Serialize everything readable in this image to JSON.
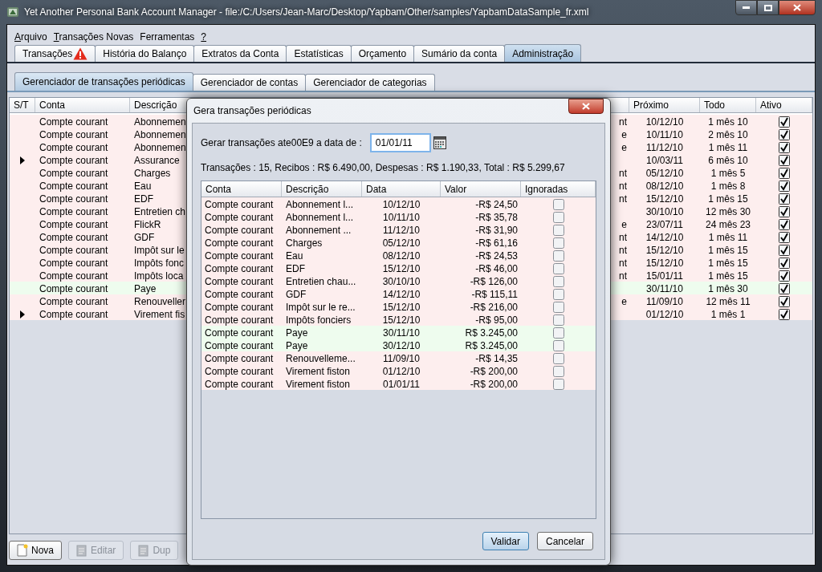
{
  "window": {
    "title": "Yet Another Personal Bank Account Manager - file:/C:/Users/Jean-Marc/Desktop/Yapbam/Other/samples/YapbamDataSample_fr.xml"
  },
  "menu": [
    {
      "label": "Arquivo",
      "mnemonic": true
    },
    {
      "label": "Transações Novas",
      "mnemonic": true
    },
    {
      "label": "Ferramentas",
      "mnemonic": false
    },
    {
      "label": "?",
      "mnemonic": true
    }
  ],
  "tabs": [
    {
      "label": "Transações",
      "selected": false,
      "warning": true
    },
    {
      "label": "História do Balanço",
      "selected": false,
      "warning": false
    },
    {
      "label": "Extratos da Conta",
      "selected": false,
      "warning": false
    },
    {
      "label": "Estatísticas",
      "selected": false,
      "warning": false
    },
    {
      "label": "Orçamento",
      "selected": false,
      "warning": false
    },
    {
      "label": "Sumário da conta",
      "selected": false,
      "warning": false
    },
    {
      "label": "Administração",
      "selected": true,
      "warning": false
    }
  ],
  "subtabs": [
    {
      "label": "Gerenciador de transações periódicas",
      "selected": true
    },
    {
      "label": "Gerenciador de contas",
      "selected": false
    },
    {
      "label": "Gerenciador de categorias",
      "selected": false
    }
  ],
  "table": {
    "columns": [
      "S/T",
      "Conta",
      "Descrição",
      "Próximo",
      "Todo",
      "Ativo"
    ],
    "rows": [
      {
        "expandable": false,
        "kind": "expense",
        "conta": "Compte courant",
        "descricao": "Abonnemen",
        "column_4": "nt",
        "proximo": "10/12/10",
        "todo": "1 mês 10",
        "ativo": true
      },
      {
        "expandable": false,
        "kind": "expense",
        "conta": "Compte courant",
        "descricao": "Abonnemen",
        "column_4": "e",
        "proximo": "10/11/10",
        "todo": "2 mês 10",
        "ativo": true
      },
      {
        "expandable": false,
        "kind": "expense",
        "conta": "Compte courant",
        "descricao": "Abonnemen",
        "column_4": "e",
        "proximo": "11/12/10",
        "todo": "1 mês 11",
        "ativo": true
      },
      {
        "expandable": true,
        "kind": "expense",
        "conta": "Compte courant",
        "descricao": "Assurance",
        "proximo": "10/03/11",
        "todo": "6 mês 10",
        "ativo": true
      },
      {
        "expandable": false,
        "kind": "expense",
        "conta": "Compte courant",
        "descricao": "Charges",
        "column_4": "nt",
        "proximo": "05/12/10",
        "todo": "1 mês 5",
        "ativo": true
      },
      {
        "expandable": false,
        "kind": "expense",
        "conta": "Compte courant",
        "descricao": "Eau",
        "column_4": "nt",
        "proximo": "08/12/10",
        "todo": "1 mês 8",
        "ativo": true
      },
      {
        "expandable": false,
        "kind": "expense",
        "conta": "Compte courant",
        "descricao": "EDF",
        "column_4": "nt",
        "proximo": "15/12/10",
        "todo": "1 mês 15",
        "ativo": true
      },
      {
        "expandable": false,
        "kind": "expense",
        "conta": "Compte courant",
        "descricao": "Entretien ch",
        "proximo": "30/10/10",
        "todo": "12 mês 30",
        "ativo": true
      },
      {
        "expandable": false,
        "kind": "expense",
        "conta": "Compte courant",
        "descricao": "FlickR",
        "column_4": "e",
        "proximo": "23/07/11",
        "todo": "24 mês 23",
        "ativo": true
      },
      {
        "expandable": false,
        "kind": "expense",
        "conta": "Compte courant",
        "descricao": "GDF",
        "column_4": "nt",
        "proximo": "14/12/10",
        "todo": "1 mês 11",
        "ativo": true
      },
      {
        "expandable": false,
        "kind": "expense",
        "conta": "Compte courant",
        "descricao": "Impôt sur le",
        "column_4": "nt",
        "proximo": "15/12/10",
        "todo": "1 mês 15",
        "ativo": true
      },
      {
        "expandable": false,
        "kind": "expense",
        "conta": "Compte courant",
        "descricao": "Impôts fonc",
        "column_4": "nt",
        "proximo": "15/12/10",
        "todo": "1 mês 15",
        "ativo": true
      },
      {
        "expandable": false,
        "kind": "expense",
        "conta": "Compte courant",
        "descricao": "Impôts loca",
        "column_4": "nt",
        "proximo": "15/01/11",
        "todo": "1 mês 15",
        "ativo": true
      },
      {
        "expandable": false,
        "kind": "income",
        "conta": "Compte courant",
        "descricao": "Paye",
        "proximo": "30/11/10",
        "todo": "1 mês 30",
        "ativo": true
      },
      {
        "expandable": false,
        "kind": "expense",
        "conta": "Compte courant",
        "descricao": "Renouveller",
        "column_4": "e",
        "proximo": "11/09/10",
        "todo": "12 mês 11",
        "ativo": true
      },
      {
        "expandable": true,
        "kind": "expense",
        "conta": "Compte courant",
        "descricao": "Virement fis",
        "proximo": "01/12/10",
        "todo": "1 mês 1",
        "ativo": true
      }
    ]
  },
  "buttons": [
    {
      "label": "Nova",
      "disabled": false
    },
    {
      "label": "Editar",
      "disabled": true
    },
    {
      "label": "Dup",
      "disabled": true
    }
  ],
  "dialog": {
    "title": "Gera transações periódicas",
    "date_label": "Gerar transações ate00E9 a data de :",
    "date_value": "01/01/11",
    "summary": "Transações : 15, Recibos : R$ 6.490,00, Despesas : R$ 1.190,33, Total : R$ 5.299,67",
    "columns": [
      "Conta",
      "Descrição",
      "Data",
      "Valor",
      "Ignoradas"
    ],
    "rows": [
      {
        "kind": "expense",
        "conta": "Compte courant",
        "descricao": "Abonnement l...",
        "data": "10/12/10",
        "valor": "-R$ 24,50",
        "ignored": false
      },
      {
        "kind": "expense",
        "conta": "Compte courant",
        "descricao": "Abonnement l...",
        "data": "10/11/10",
        "valor": "-R$ 35,78",
        "ignored": false
      },
      {
        "kind": "expense",
        "conta": "Compte courant",
        "descricao": "Abonnement ...",
        "data": "11/12/10",
        "valor": "-R$ 31,90",
        "ignored": false
      },
      {
        "kind": "expense",
        "conta": "Compte courant",
        "descricao": "Charges",
        "data": "05/12/10",
        "valor": "-R$ 61,16",
        "ignored": false
      },
      {
        "kind": "expense",
        "conta": "Compte courant",
        "descricao": "Eau",
        "data": "08/12/10",
        "valor": "-R$ 24,53",
        "ignored": false
      },
      {
        "kind": "expense",
        "conta": "Compte courant",
        "descricao": "EDF",
        "data": "15/12/10",
        "valor": "-R$ 46,00",
        "ignored": false
      },
      {
        "kind": "expense",
        "conta": "Compte courant",
        "descricao": "Entretien chau...",
        "data": "30/10/10",
        "valor": "-R$ 126,00",
        "ignored": false
      },
      {
        "kind": "expense",
        "conta": "Compte courant",
        "descricao": "GDF",
        "data": "14/12/10",
        "valor": "-R$ 115,11",
        "ignored": false
      },
      {
        "kind": "expense",
        "conta": "Compte courant",
        "descricao": "Impôt sur le re...",
        "data": "15/12/10",
        "valor": "-R$ 216,00",
        "ignored": false
      },
      {
        "kind": "expense",
        "conta": "Compte courant",
        "descricao": "Impôts fonciers",
        "data": "15/12/10",
        "valor": "-R$ 95,00",
        "ignored": false
      },
      {
        "kind": "income",
        "conta": "Compte courant",
        "descricao": "Paye",
        "data": "30/11/10",
        "valor": "R$ 3.245,00",
        "ignored": false
      },
      {
        "kind": "income",
        "conta": "Compte courant",
        "descricao": "Paye",
        "data": "30/12/10",
        "valor": "R$ 3.245,00",
        "ignored": false
      },
      {
        "kind": "expense",
        "conta": "Compte courant",
        "descricao": "Renouvelleme...",
        "data": "11/09/10",
        "valor": "-R$ 14,35",
        "ignored": false
      },
      {
        "kind": "expense",
        "conta": "Compte courant",
        "descricao": "Virement fiston",
        "data": "01/12/10",
        "valor": "-R$ 200,00",
        "ignored": false
      },
      {
        "kind": "expense",
        "conta": "Compte courant",
        "descricao": "Virement fiston",
        "data": "01/01/11",
        "valor": "-R$ 200,00",
        "ignored": false
      }
    ],
    "buttons": [
      {
        "label": "Validar",
        "default": true
      },
      {
        "label": "Cancelar",
        "default": false
      }
    ]
  }
}
